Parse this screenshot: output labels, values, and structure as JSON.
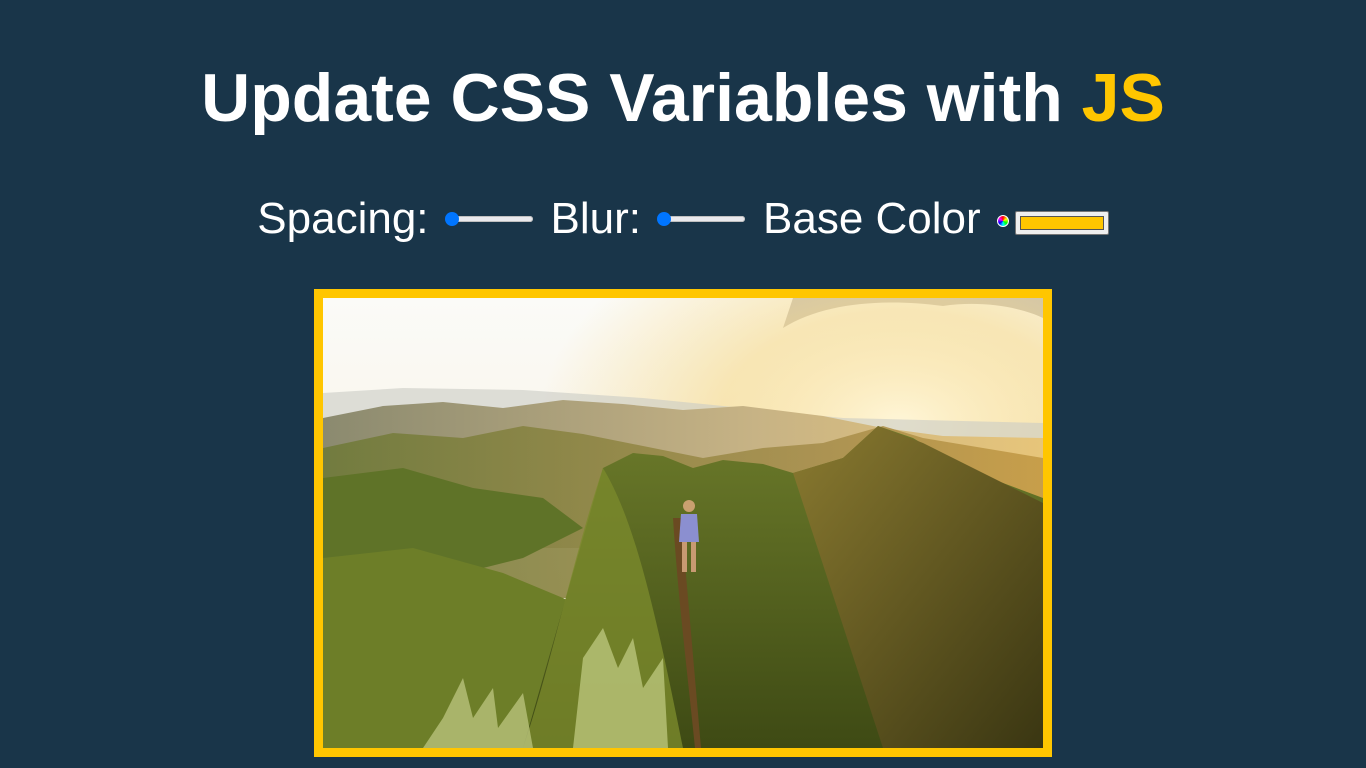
{
  "header": {
    "title_main": "Update CSS Variables with ",
    "title_highlight": "JS"
  },
  "controls": {
    "spacing_label": "Spacing:",
    "spacing_value": 10,
    "spacing_min": 10,
    "spacing_max": 200,
    "blur_label": "Blur:",
    "blur_value": 0,
    "blur_min": 0,
    "blur_max": 25,
    "base_color_label": "Base Color",
    "base_color_value": "#ffc600"
  },
  "image": {
    "alt_icon": "mountain-hiker-photo"
  },
  "colors": {
    "background": "#193549",
    "accent": "#ffc600",
    "text": "#ffffff",
    "slider": "#0075ff"
  }
}
